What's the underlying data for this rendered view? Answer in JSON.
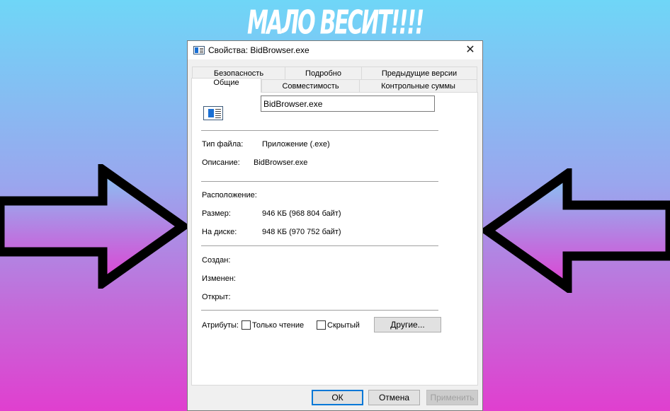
{
  "banner": {
    "text": "МАЛО ВЕСИТ!!!!"
  },
  "window": {
    "title": "Свойства: BidBrowser.exe",
    "close_label": "✕"
  },
  "tabs_row1": [
    "Безопасность",
    "Подробно",
    "Предыдущие версии"
  ],
  "tabs_row2": [
    "Общие",
    "Совместимость",
    "Контрольные суммы"
  ],
  "general": {
    "filename": "BidBrowser.exe",
    "file_type_label": "Тип файла:",
    "file_type_value": "Приложение (.exe)",
    "description_label": "Описание:",
    "description_value": "BidBrowser.exe",
    "location_label": "Расположение:",
    "size_label": "Размер:",
    "size_value": "946 КБ (968 804 байт)",
    "disk_label": "На диске:",
    "disk_value": "948 КБ (970 752 байт)",
    "created_label": "Создан:",
    "modified_label": "Изменен:",
    "opened_label": "Открыт:",
    "attributes_label": "Атрибуты:",
    "readonly_label": "Только чтение",
    "hidden_label": "Скрытый",
    "other_button": "Другие..."
  },
  "buttons": {
    "ok": "ОК",
    "cancel": "Отмена",
    "apply": "Применить"
  },
  "colors": {
    "arrow_stroke": "#000000",
    "gradient_top": "#6fd6f7",
    "gradient_bottom": "#e03fcf"
  }
}
